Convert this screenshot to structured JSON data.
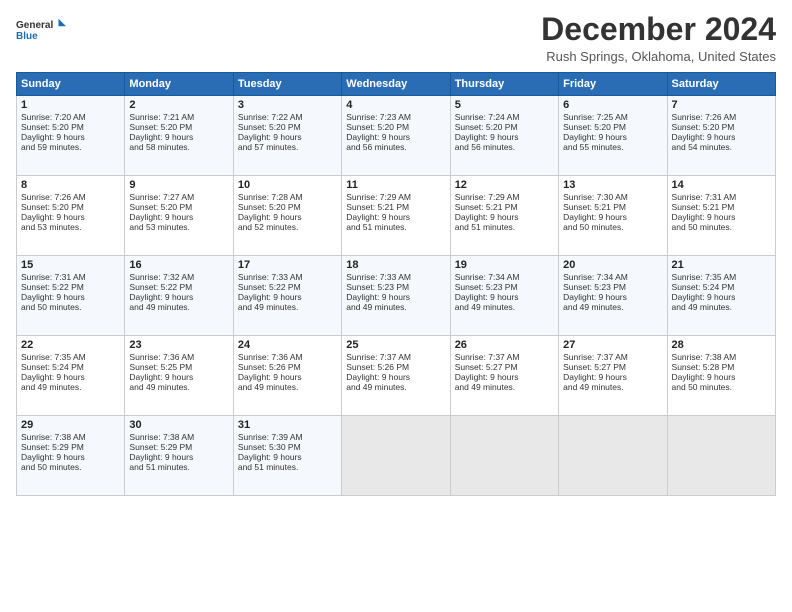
{
  "logo": {
    "general": "General",
    "blue": "Blue"
  },
  "title": "December 2024",
  "location": "Rush Springs, Oklahoma, United States",
  "days_header": [
    "Sunday",
    "Monday",
    "Tuesday",
    "Wednesday",
    "Thursday",
    "Friday",
    "Saturday"
  ],
  "weeks": [
    [
      {
        "day": "1",
        "lines": [
          "Sunrise: 7:20 AM",
          "Sunset: 5:20 PM",
          "Daylight: 9 hours",
          "and 59 minutes."
        ]
      },
      {
        "day": "2",
        "lines": [
          "Sunrise: 7:21 AM",
          "Sunset: 5:20 PM",
          "Daylight: 9 hours",
          "and 58 minutes."
        ]
      },
      {
        "day": "3",
        "lines": [
          "Sunrise: 7:22 AM",
          "Sunset: 5:20 PM",
          "Daylight: 9 hours",
          "and 57 minutes."
        ]
      },
      {
        "day": "4",
        "lines": [
          "Sunrise: 7:23 AM",
          "Sunset: 5:20 PM",
          "Daylight: 9 hours",
          "and 56 minutes."
        ]
      },
      {
        "day": "5",
        "lines": [
          "Sunrise: 7:24 AM",
          "Sunset: 5:20 PM",
          "Daylight: 9 hours",
          "and 56 minutes."
        ]
      },
      {
        "day": "6",
        "lines": [
          "Sunrise: 7:25 AM",
          "Sunset: 5:20 PM",
          "Daylight: 9 hours",
          "and 55 minutes."
        ]
      },
      {
        "day": "7",
        "lines": [
          "Sunrise: 7:26 AM",
          "Sunset: 5:20 PM",
          "Daylight: 9 hours",
          "and 54 minutes."
        ]
      }
    ],
    [
      {
        "day": "8",
        "lines": [
          "Sunrise: 7:26 AM",
          "Sunset: 5:20 PM",
          "Daylight: 9 hours",
          "and 53 minutes."
        ]
      },
      {
        "day": "9",
        "lines": [
          "Sunrise: 7:27 AM",
          "Sunset: 5:20 PM",
          "Daylight: 9 hours",
          "and 53 minutes."
        ]
      },
      {
        "day": "10",
        "lines": [
          "Sunrise: 7:28 AM",
          "Sunset: 5:20 PM",
          "Daylight: 9 hours",
          "and 52 minutes."
        ]
      },
      {
        "day": "11",
        "lines": [
          "Sunrise: 7:29 AM",
          "Sunset: 5:21 PM",
          "Daylight: 9 hours",
          "and 51 minutes."
        ]
      },
      {
        "day": "12",
        "lines": [
          "Sunrise: 7:29 AM",
          "Sunset: 5:21 PM",
          "Daylight: 9 hours",
          "and 51 minutes."
        ]
      },
      {
        "day": "13",
        "lines": [
          "Sunrise: 7:30 AM",
          "Sunset: 5:21 PM",
          "Daylight: 9 hours",
          "and 50 minutes."
        ]
      },
      {
        "day": "14",
        "lines": [
          "Sunrise: 7:31 AM",
          "Sunset: 5:21 PM",
          "Daylight: 9 hours",
          "and 50 minutes."
        ]
      }
    ],
    [
      {
        "day": "15",
        "lines": [
          "Sunrise: 7:31 AM",
          "Sunset: 5:22 PM",
          "Daylight: 9 hours",
          "and 50 minutes."
        ]
      },
      {
        "day": "16",
        "lines": [
          "Sunrise: 7:32 AM",
          "Sunset: 5:22 PM",
          "Daylight: 9 hours",
          "and 49 minutes."
        ]
      },
      {
        "day": "17",
        "lines": [
          "Sunrise: 7:33 AM",
          "Sunset: 5:22 PM",
          "Daylight: 9 hours",
          "and 49 minutes."
        ]
      },
      {
        "day": "18",
        "lines": [
          "Sunrise: 7:33 AM",
          "Sunset: 5:23 PM",
          "Daylight: 9 hours",
          "and 49 minutes."
        ]
      },
      {
        "day": "19",
        "lines": [
          "Sunrise: 7:34 AM",
          "Sunset: 5:23 PM",
          "Daylight: 9 hours",
          "and 49 minutes."
        ]
      },
      {
        "day": "20",
        "lines": [
          "Sunrise: 7:34 AM",
          "Sunset: 5:23 PM",
          "Daylight: 9 hours",
          "and 49 minutes."
        ]
      },
      {
        "day": "21",
        "lines": [
          "Sunrise: 7:35 AM",
          "Sunset: 5:24 PM",
          "Daylight: 9 hours",
          "and 49 minutes."
        ]
      }
    ],
    [
      {
        "day": "22",
        "lines": [
          "Sunrise: 7:35 AM",
          "Sunset: 5:24 PM",
          "Daylight: 9 hours",
          "and 49 minutes."
        ]
      },
      {
        "day": "23",
        "lines": [
          "Sunrise: 7:36 AM",
          "Sunset: 5:25 PM",
          "Daylight: 9 hours",
          "and 49 minutes."
        ]
      },
      {
        "day": "24",
        "lines": [
          "Sunrise: 7:36 AM",
          "Sunset: 5:26 PM",
          "Daylight: 9 hours",
          "and 49 minutes."
        ]
      },
      {
        "day": "25",
        "lines": [
          "Sunrise: 7:37 AM",
          "Sunset: 5:26 PM",
          "Daylight: 9 hours",
          "and 49 minutes."
        ]
      },
      {
        "day": "26",
        "lines": [
          "Sunrise: 7:37 AM",
          "Sunset: 5:27 PM",
          "Daylight: 9 hours",
          "and 49 minutes."
        ]
      },
      {
        "day": "27",
        "lines": [
          "Sunrise: 7:37 AM",
          "Sunset: 5:27 PM",
          "Daylight: 9 hours",
          "and 49 minutes."
        ]
      },
      {
        "day": "28",
        "lines": [
          "Sunrise: 7:38 AM",
          "Sunset: 5:28 PM",
          "Daylight: 9 hours",
          "and 50 minutes."
        ]
      }
    ],
    [
      {
        "day": "29",
        "lines": [
          "Sunrise: 7:38 AM",
          "Sunset: 5:29 PM",
          "Daylight: 9 hours",
          "and 50 minutes."
        ]
      },
      {
        "day": "30",
        "lines": [
          "Sunrise: 7:38 AM",
          "Sunset: 5:29 PM",
          "Daylight: 9 hours",
          "and 51 minutes."
        ]
      },
      {
        "day": "31",
        "lines": [
          "Sunrise: 7:39 AM",
          "Sunset: 5:30 PM",
          "Daylight: 9 hours",
          "and 51 minutes."
        ]
      },
      null,
      null,
      null,
      null
    ]
  ]
}
